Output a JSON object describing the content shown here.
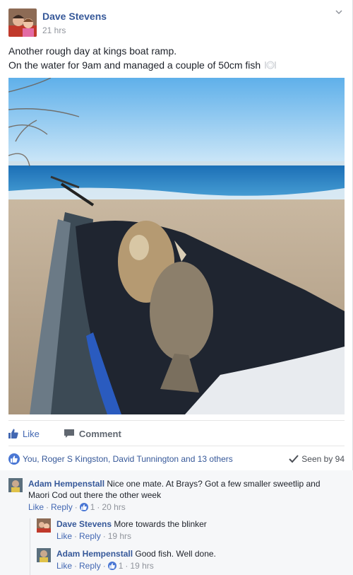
{
  "post": {
    "author": "Dave Stevens",
    "time": "21 hrs",
    "text_line1": "Another rough day at kings boat ramp.",
    "text_line2": "On the water for 9am and managed a couple of 50cm fish",
    "emoji_icon": "plate-fork-knife-icon"
  },
  "actions": {
    "like_label": "Like",
    "comment_label": "Comment"
  },
  "reactions": {
    "summary": "You, Roger S Kingston, David Tunnington and 13 others",
    "seen": "Seen by 94"
  },
  "comments": [
    {
      "author": "Adam Hempenstall",
      "text_line1": "Nice one mate. At Brays? Got a few smaller sweetlip and",
      "text_line2": "Maori Cod out there the other week",
      "like": "Like",
      "reply": "Reply",
      "likes": "1",
      "time": "20 hrs"
    },
    {
      "author": "Dave Stevens",
      "text": "More towards the blinker",
      "like": "Like",
      "reply": "Reply",
      "time": "19 hrs"
    },
    {
      "author": "Adam Hempenstall",
      "text": "Good fish. Well done.",
      "like": "Like",
      "reply": "Reply",
      "likes": "1",
      "time": "19 hrs"
    }
  ],
  "colors": {
    "link": "#365899",
    "action_blue": "#4267b2",
    "muted": "#90949c",
    "comment_bg": "#f6f7f9"
  }
}
